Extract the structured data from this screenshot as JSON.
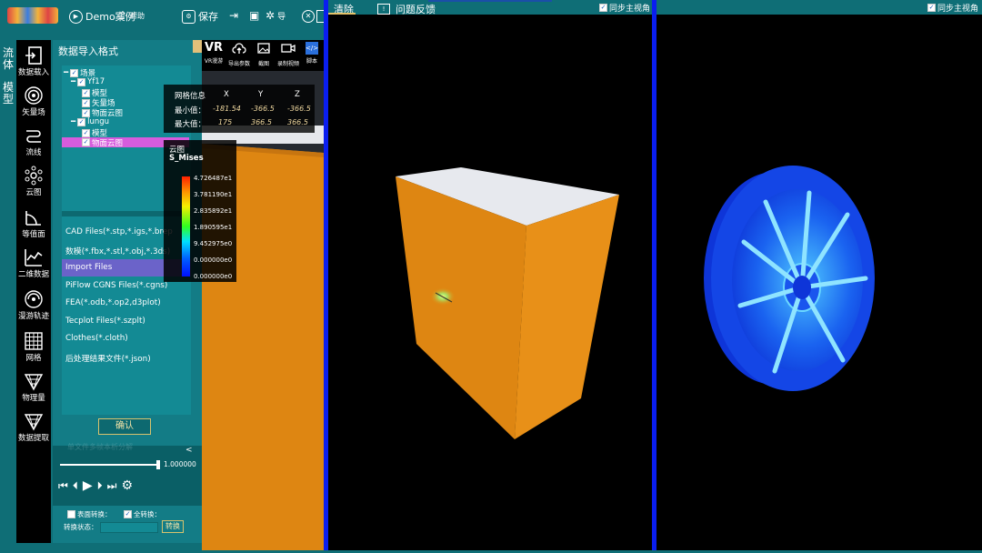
{
  "topbar": {
    "demo_label": "Demo案例",
    "help_label": "帮助",
    "save_label": "保存",
    "overlap_label": "导"
  },
  "left_tabs": {
    "fluid": "流体",
    "model": "模型"
  },
  "tools": [
    {
      "label": "数据载入",
      "icon": "import-icon"
    },
    {
      "label": "矢量场",
      "icon": "vector-field-icon"
    },
    {
      "label": "流线",
      "icon": "streamline-icon"
    },
    {
      "label": "云图",
      "icon": "contour-icon"
    },
    {
      "label": "等值面",
      "icon": "isosurface-icon"
    },
    {
      "label": "二维数据",
      "icon": "chart-icon"
    },
    {
      "label": "漫游轨迹",
      "icon": "roam-icon"
    },
    {
      "label": "网格",
      "icon": "grid-icon"
    },
    {
      "label": "物理量",
      "icon": "physics-icon"
    },
    {
      "label": "数据提取",
      "icon": "extract-icon"
    }
  ],
  "panel": {
    "title": "数据导入格式",
    "tree": {
      "root": "场景",
      "n1": "Yf17",
      "n1a": "模型",
      "n1b": "矢量场",
      "n1c": "物面云图",
      "n2": "lungu",
      "n2a": "模型",
      "n2b": "物面云图"
    },
    "files": [
      "CAD Files(*.stp,*.igs,*.brep",
      "数模(*.fbx,*.stl,*.obj,*.3ds)",
      "Import Files",
      "PiFlow CGNS Files(*.cgns)",
      "FEA(*.odb,*.op2,d3plot)",
      "Tecplot Files(*.szplt)",
      "Clothes(*.cloth)",
      "后处理结果文件(*.json)"
    ],
    "confirm_label": "确认",
    "hidden_text": "单文件多帧本析分解",
    "collapse": "<",
    "slider_value": "1.000000",
    "surface_convert": "表面转换：",
    "full_convert": "全转换：",
    "convert_status": "转换状态：",
    "convert_button": "转换"
  },
  "view_tools": [
    {
      "label": "VR漫游",
      "icon": "vr-icon"
    },
    {
      "label": "导出参数",
      "icon": "cloud-upload-icon"
    },
    {
      "label": "截图",
      "icon": "image-icon"
    },
    {
      "label": "录制视频",
      "icon": "video-icon"
    },
    {
      "label": "脚本",
      "icon": "script-icon"
    }
  ],
  "mesh_info": {
    "title": "网格信息",
    "x": "X",
    "y": "Y",
    "z": "Z",
    "min_label": "最小值：",
    "max_label": "最大值：",
    "min": [
      "-181.54",
      "-366.5",
      "-366.5"
    ],
    "max": [
      "175",
      "366.5",
      "366.5"
    ]
  },
  "legend": {
    "title": "云图",
    "variable": "S_Mises",
    "values": [
      "4.726487e1",
      "3.781190e1",
      "2.835892e1",
      "1.890595e1",
      "9.452975e0",
      "0.000000e0",
      "0.000000e0"
    ]
  },
  "view2": {
    "clear_label": "清除",
    "feedback_label": "问题反馈",
    "sync_label": "同步主视角"
  },
  "view3": {
    "sync_label": "同步主视角"
  },
  "colors": {
    "teal": "#0f6e76",
    "divider": "#0a1ef0",
    "box": "#e08a10",
    "wheel": "#1446e6"
  }
}
